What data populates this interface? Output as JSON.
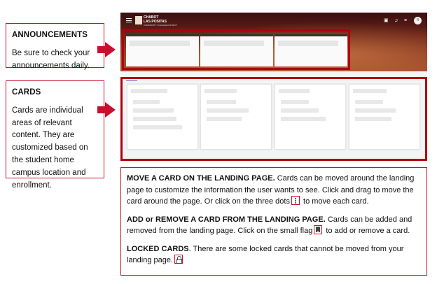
{
  "announcements_note": {
    "title": "ANNOUNCEMENTS",
    "body": "Be sure to check your announcements daily."
  },
  "cards_note": {
    "title": "CARDS",
    "body": "Cards are individual areas of relevant content. They are customized based on the student home campus location and enrollment."
  },
  "screen": {
    "logo_line1": "CHABOT",
    "logo_line2": "LAS POSITAS",
    "logo_line3": "COMMUNITY COLLEGE DISTRICT",
    "avatar_initial": "R"
  },
  "instructions": {
    "move": {
      "heading": "MOVE A CARD ON THE LANDING PAGE.",
      "text_before": " Cards can be moved around the landing page to customize the information the user wants to see. Click and drag to move the card around the page.  Or click on the three dots",
      "text_after": " to move each card."
    },
    "add_remove": {
      "heading": "ADD or REMOVE A CARD FROM THE LANDING PAGE.",
      "text_before": "  Cards can be added and removed from the landing page. Click on the small flag",
      "text_after": " to add or remove a card."
    },
    "locked": {
      "heading": "LOCKED CARDS",
      "text_before": ". There are some locked cards that cannot be moved from your landing page.",
      "text_after": ""
    }
  },
  "icons": {
    "dots": "three-dots-vertical-icon",
    "flag": "bookmark-flag-icon",
    "lock": "lock-icon"
  },
  "colors": {
    "accent_red": "#c8102e",
    "frame_red": "#b00010"
  }
}
